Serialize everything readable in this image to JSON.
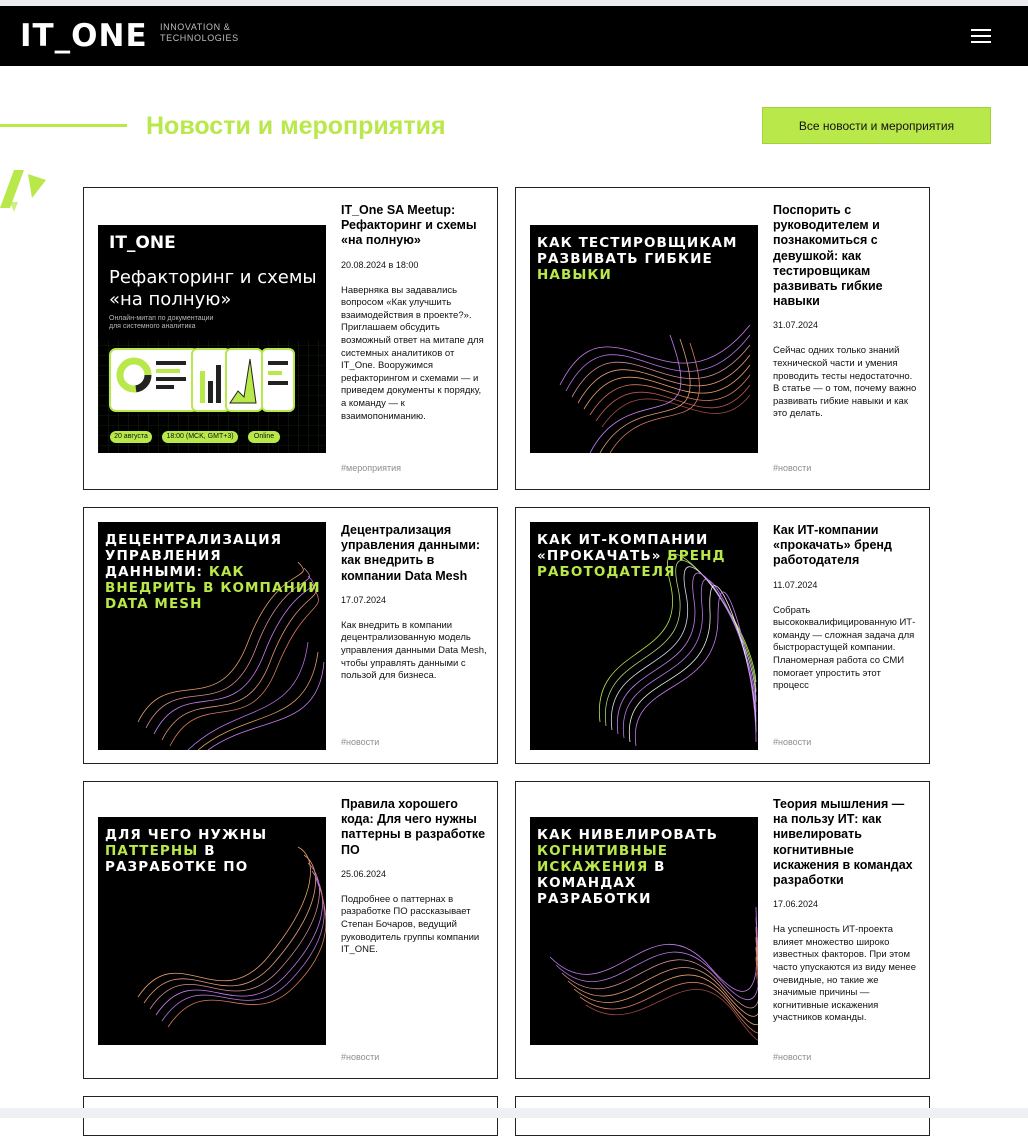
{
  "header": {
    "logo_text": "IT_ONE",
    "tagline_line1": "INNOVATION &",
    "tagline_line2": "TECHNOLOGIES",
    "menu_icon": "hamburger-menu-icon"
  },
  "section": {
    "title": "Новости и мероприятия",
    "all_button_label": "Все новости и мероприятия"
  },
  "colors": {
    "accent": "#b9e84a",
    "header_bg": "#000000"
  },
  "cards": [
    {
      "title": "IT_One SA Meetup: Рефакторинг и схемы «на полную»",
      "date": "20.08.2024 в 18:00",
      "description": "Наверняка вы задавались вопросом «Как улучшить взаимодействия в проекте?». Приглашаем обсудить возможный ответ на митапе для системных аналитиков от IT_One. Вооружимся рефакторингом и схемами — и приведем документы к порядку, а команду — к взаимопониманию.",
      "tag": "#мероприятия",
      "image": {
        "logo": "IT_ONE",
        "title_line1": "Рефакторинг и схемы",
        "title_line2": "«на полную»",
        "subtitle_line1": "Онлайн-митап по документации",
        "subtitle_line2": "для системного аналитика",
        "pill_date": "20 августа",
        "pill_time": "18:00 (MCK, GMT+3)",
        "pill_format": "Online"
      }
    },
    {
      "title": "Поспорить с руководителем и познакомиться с девушкой: как тестировщикам развивать гибкие навыки",
      "date": "31.07.2024",
      "description": "Сейчас одних только знаний технической части и умения проводить тесты недостаточно. В статье — о том, почему важно развивать гибкие навыки и как это делать.",
      "tag": "#новости",
      "image": {
        "white": "Как тестировщикам развивать гибкие",
        "green": "навыки",
        "white_after": ""
      }
    },
    {
      "title": "Децентрализация управления данными: как внедрить в компании Data Mesh",
      "date": "17.07.2024",
      "description": "Как внедрить в компании децентрализованную модель управления данными Data Mesh, чтобы управлять данными с пользой для бизнеса.",
      "tag": "#новости",
      "image": {
        "white": "Децентрализация управления данными:",
        "green": "как внедрить в компании Data Mesh",
        "white_after": ""
      }
    },
    {
      "title": "Как ИТ-компании «прокачать» бренд работодателя",
      "date": "11.07.2024",
      "description": "Собрать высококвалифицированную ИТ-команду — сложная задача для быстрорастущей компании. Планомерная работа со СМИ помогает упростить этот процесс",
      "tag": "#новости",
      "image": {
        "white": "Как ИТ-компании «прокачать»",
        "green": "бренд работодателя",
        "white_after": ""
      }
    },
    {
      "title": "Правила хорошего кода: Для чего нужны паттерны в разработке ПО",
      "date": "25.06.2024",
      "description": "Подробнее о паттернах в разработке ПО рассказывает Степан Бочаров, ведущий руководитель группы компании IT_ONE.",
      "tag": "#новости",
      "image": {
        "white": "Для чего нужны",
        "green": "паттерны",
        "white_after": "в разработке ПО"
      }
    },
    {
      "title": "Теория мышления — на пользу ИТ: как нивелировать когнитивные искажения в командах разработки",
      "date": "17.06.2024",
      "description": "На успешность ИТ-проекта влияет множество широко известных факторов. При этом часто упускаются из виду менее очевидные, но такие же значимые причины — когнитивные искажения участников команды.",
      "tag": "#новости",
      "image": {
        "white": "Как нивелировать",
        "green": "когнитивные искажения",
        "white_after": "в командах разработки"
      }
    }
  ]
}
